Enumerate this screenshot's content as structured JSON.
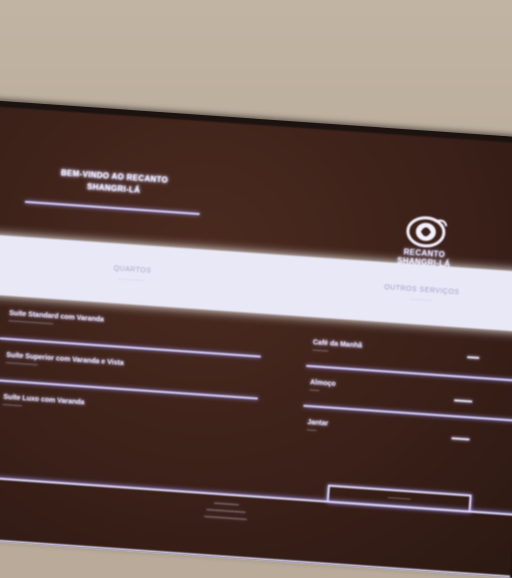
{
  "sign": {
    "welcome_line1": "BEM-VINDO AO RECANTO",
    "welcome_line2": "SHANGRI-LÁ",
    "logo": {
      "name_line1": "RECANTO",
      "name_line2": "SHANGRI-LÁ",
      "icon": "shell-emblem-icon"
    },
    "band": {
      "left_title": "QUARTOS",
      "right_title": "OUTROS SERVIÇOS"
    },
    "rooms": [
      {
        "name": "Suíte Standard com Varanda"
      },
      {
        "name": "Suíte Superior com Varanda e Vista"
      },
      {
        "name": "Suíte Luxo com Varanda"
      }
    ],
    "services": [
      {
        "name": "Café da Manhã"
      },
      {
        "name": "Almoço"
      },
      {
        "name": "Jantar"
      }
    ]
  },
  "colors": {
    "screen": "#3a2018",
    "glow_text": "#f3f0ff",
    "band": "#e9e8f7",
    "wall": "#b9aa99"
  }
}
